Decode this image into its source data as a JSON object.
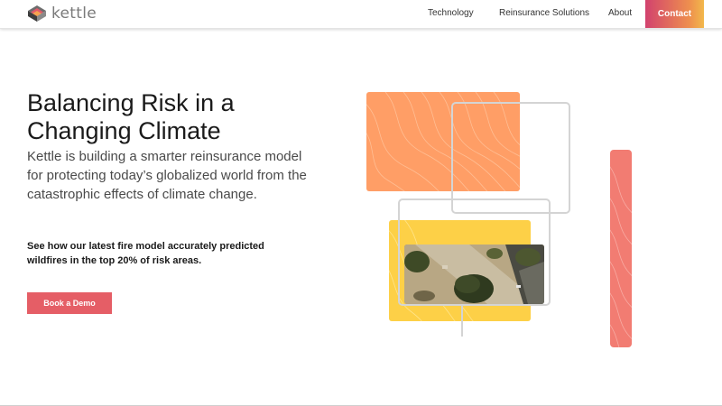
{
  "brand": {
    "name": "kettle"
  },
  "nav": {
    "links": [
      "Technology",
      "Reinsurance Solutions",
      "About"
    ],
    "contact_label": "Contact"
  },
  "hero": {
    "headline_line1": "Balancing Risk in a",
    "headline_line2": "Changing Climate",
    "subtext": "Kettle is building a smarter reinsurance model for protecting today’s globalized world from the catastrophic effects of climate change.",
    "callout": "See how our latest fire model accurately predicted wildfires in the top 20% of risk areas.",
    "cta_label": "Book a Demo"
  },
  "colors": {
    "orange_panel": "#ff9e66",
    "yellow_panel": "#fdd047",
    "coral_bar": "#f27c72",
    "cta": "#e55e66",
    "contact_gradient": [
      "#d2426e",
      "#ee8f4e",
      "#f2b84b"
    ]
  }
}
